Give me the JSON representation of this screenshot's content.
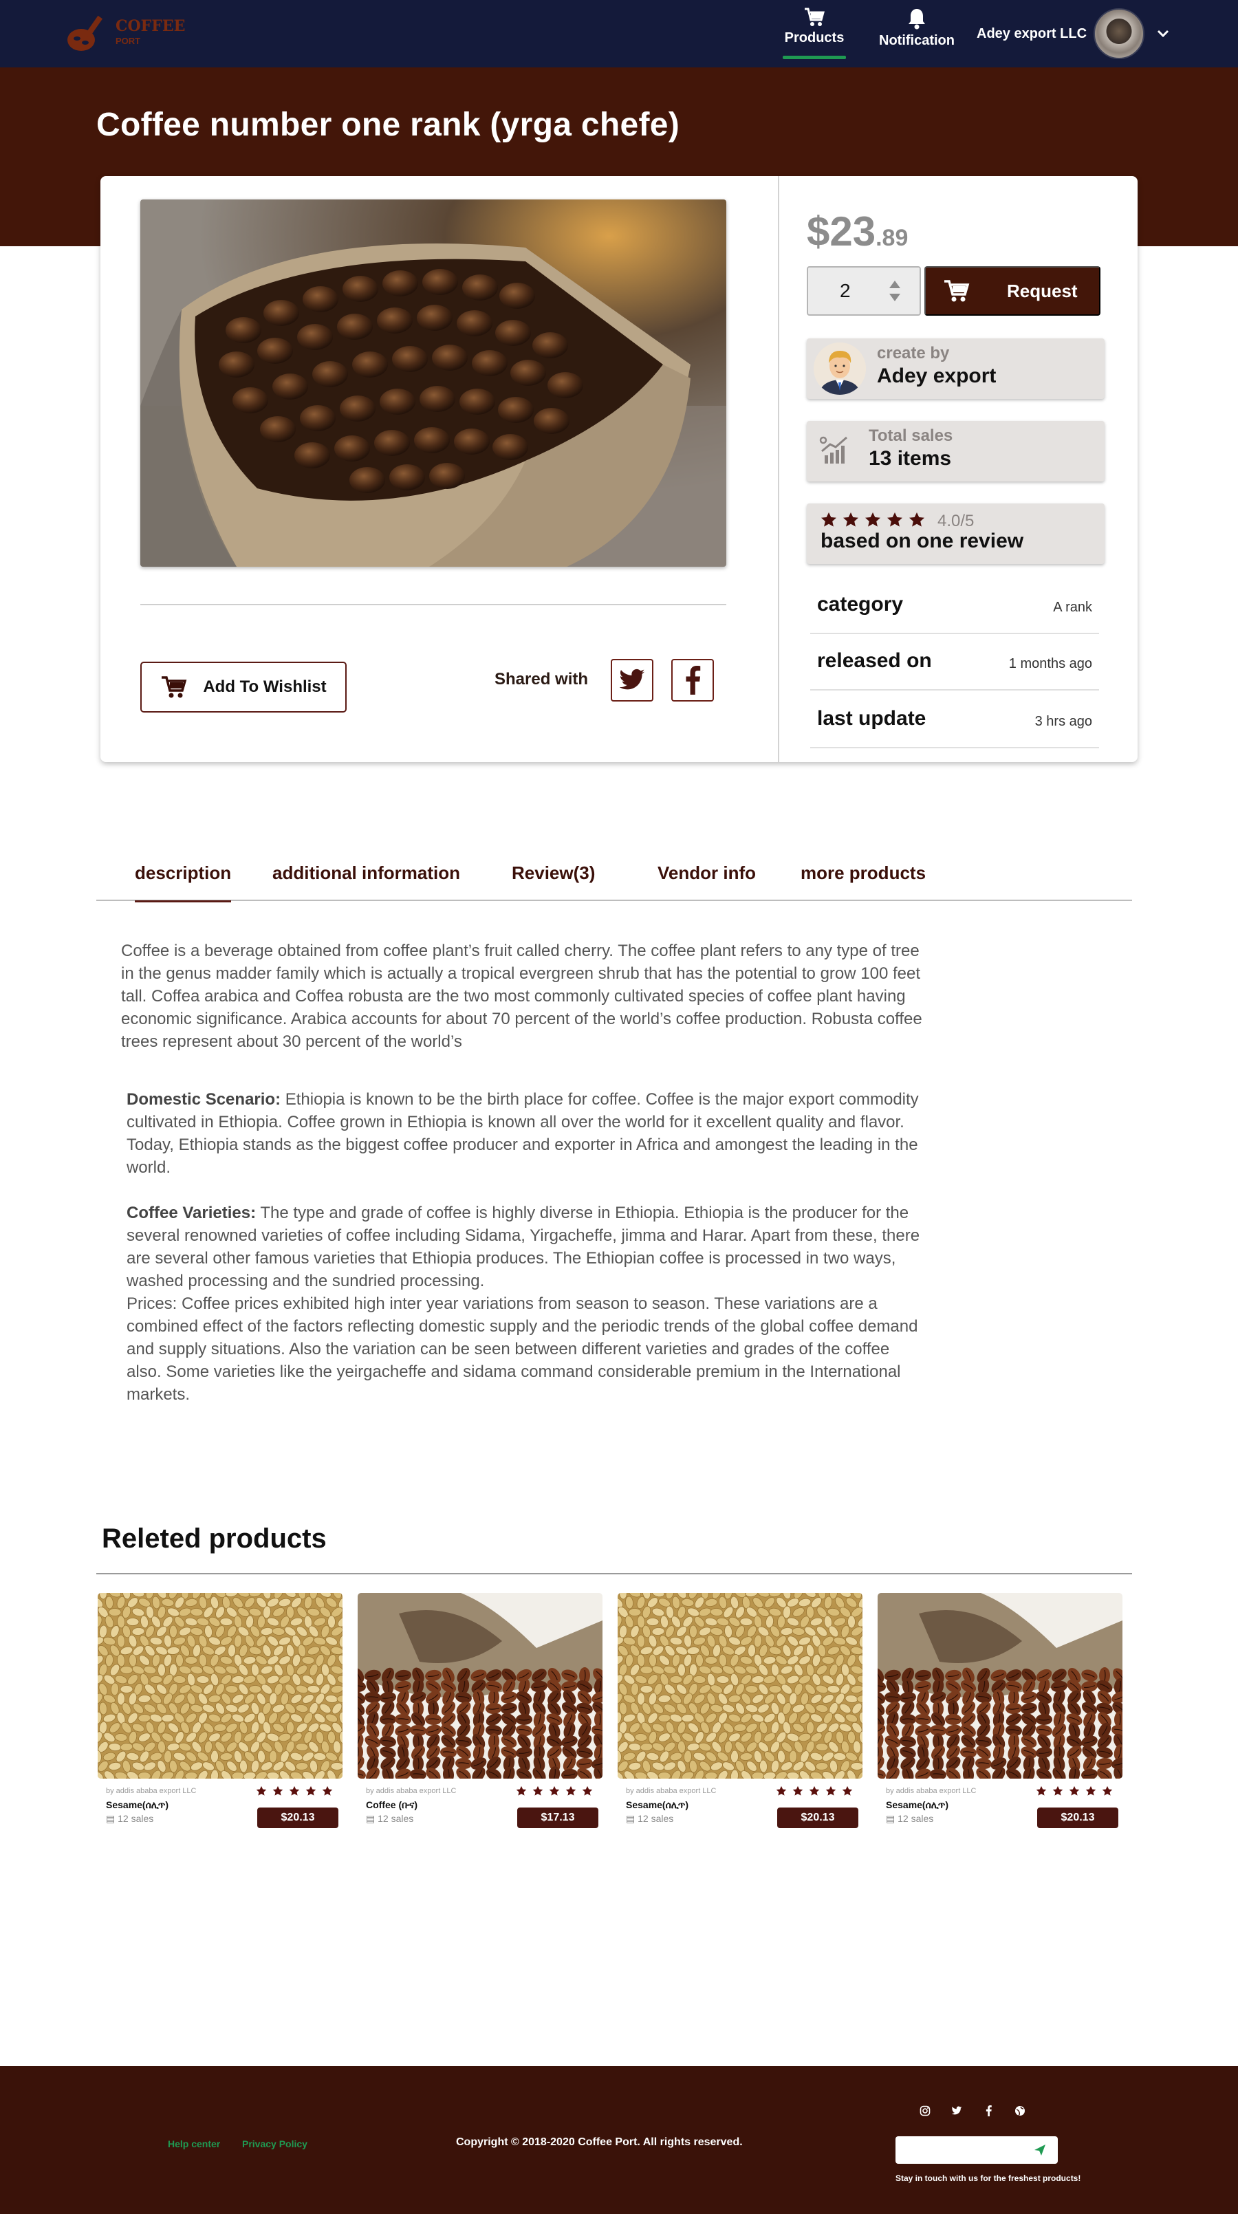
{
  "nav": {
    "logo_text": "COFFEE",
    "logo_sub": "PORT",
    "products_label": "Products",
    "notification_label": "Notification",
    "account_name": "Adey export LLC"
  },
  "hero": {
    "title": "Coffee number one rank (yrga chefe)"
  },
  "product": {
    "price_main": "$23",
    "price_cents": ".89",
    "quantity": "2",
    "request_label": "Request",
    "creator_label": "create by",
    "creator_name": "Adey export",
    "sales_label": "Total sales",
    "sales_value": "13 items",
    "rating": 4.0,
    "rating_text": "4.0/5",
    "review_text": "based on one review",
    "meta": [
      {
        "key": "category",
        "value": "A rank"
      },
      {
        "key": "released on",
        "value": "1 months ago"
      },
      {
        "key": "last update",
        "value": "3 hrs ago"
      }
    ],
    "wishlist_label": "Add To Wishlist",
    "shared_label": "Shared with"
  },
  "tabs": [
    {
      "label": "description",
      "active": true
    },
    {
      "label": "additional information",
      "active": false
    },
    {
      "label": "Review(3)",
      "active": false
    },
    {
      "label": "Vendor info",
      "active": false
    },
    {
      "label": "more products",
      "active": false
    }
  ],
  "description": {
    "intro": "Coffee is a beverage obtained from coffee plant’s fruit called cherry. The coffee plant refers to any type of tree in the genus madder family which is actually a tropical evergreen shrub that has the potential to grow 100 feet tall. Coffea arabica and Coffea robusta are the two most commonly cultivated species of coffee plant having economic significance. Arabica accounts for about 70 percent of the world’s coffee production. Robusta coffee trees represent about 30 percent of the world’s",
    "domestic_head": "Domestic Scenario:",
    "domestic_body": " Ethiopia is known to be the birth place for coffee. Coffee is the major export commodity cultivated in Ethiopia. Coffee grown in Ethiopia is known all over the world for it excellent quality and flavor. Today, Ethiopia stands as the biggest coffee producer and exporter in Africa and amongest the leading in the world.",
    "varieties_head": "Coffee Varieties:",
    "varieties_body": " The type and grade of coffee is highly diverse in Ethiopia. Ethiopia is the producer for the several renowned varieties of coffee including Sidama, Yirgacheffe, jimma and Harar. Apart from these, there are several other famous varieties that Ethiopia produces. The Ethiopian coffee is processed in two ways, washed processing and the sundried processing.",
    "prices": "Prices: Coffee prices exhibited high inter year variations from season to season. These variations are a combined effect of the factors reflecting domestic supply and the periodic trends of the global coffee demand and supply situations. Also the variation can be seen between different varieties and grades of the coffee also. Some varieties like the yeirgacheffe and sidama command considerable premium in the International markets."
  },
  "related": {
    "title": "Releted products",
    "items": [
      {
        "by": "by addis ababa export LLC",
        "name": "Sesame(ሰሊጥ)",
        "sales": "12 sales",
        "price": "$20.13",
        "kind": "sesame"
      },
      {
        "by": "by addis ababa export LLC",
        "name": "Coffee (ቡና)",
        "sales": "12 sales",
        "price": "$17.13",
        "kind": "coffee"
      },
      {
        "by": "by addis ababa export LLC",
        "name": "Sesame(ሰሊጥ)",
        "sales": "12 sales",
        "price": "$20.13",
        "kind": "sesame"
      },
      {
        "by": "by addis ababa export LLC",
        "name": "Sesame(ሰሊጥ)",
        "sales": "12 sales",
        "price": "$20.13",
        "kind": "coffee"
      }
    ]
  },
  "footer": {
    "help": "Help center",
    "privacy": "Privacy Policy",
    "copyright": "Copyright © 2018-2020 Coffee Port. All rights reserved.",
    "note": "Stay in touch with us for the freshest products!",
    "input_placeholder": ""
  },
  "colors": {
    "nav": "#141a3a",
    "brand": "#431609",
    "accent_green": "#1f9a52",
    "footer": "#3a1209"
  }
}
